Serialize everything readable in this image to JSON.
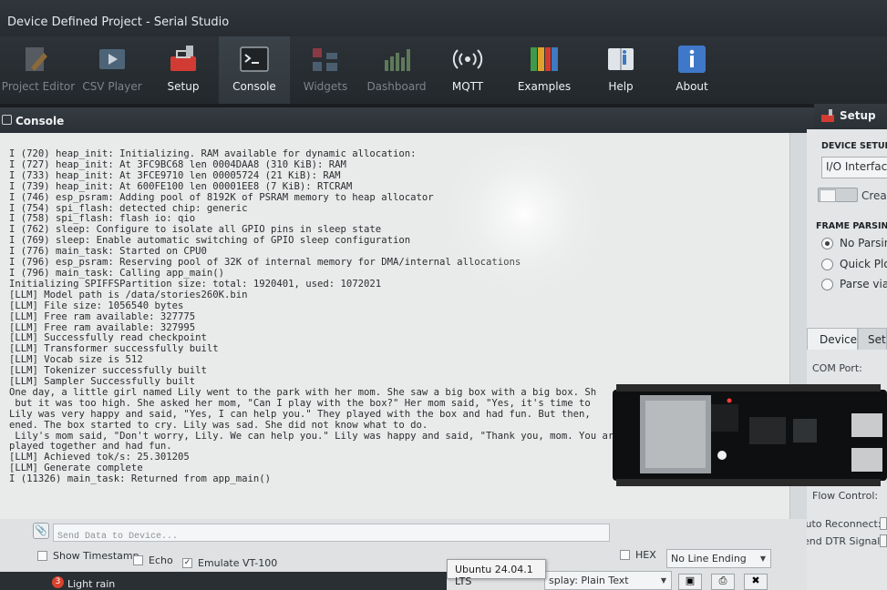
{
  "window": {
    "title": "Device Defined Project - Serial Studio"
  },
  "toolbar": {
    "items": [
      {
        "label": "Project Editor",
        "icon": "pencil-icon"
      },
      {
        "label": "CSV Player",
        "icon": "play-icon"
      },
      {
        "label": "Setup",
        "icon": "toolbox-icon"
      },
      {
        "label": "Console",
        "icon": "terminal-icon"
      },
      {
        "label": "Widgets",
        "icon": "widgets-icon"
      },
      {
        "label": "Dashboard",
        "icon": "bar-chart-icon"
      },
      {
        "label": "MQTT",
        "icon": "broadcast-icon"
      },
      {
        "label": "Examples",
        "icon": "books-icon"
      },
      {
        "label": "Help",
        "icon": "help-book-icon"
      },
      {
        "label": "About",
        "icon": "info-icon"
      }
    ]
  },
  "console": {
    "title": "Console",
    "lines": [
      "I (720) heap_init: Initializing. RAM available for dynamic allocation:",
      "I (727) heap_init: At 3FC9BC68 len 0004DAA8 (310 KiB): RAM",
      "I (733) heap_init: At 3FCE9710 len 00005724 (21 KiB): RAM",
      "I (739) heap_init: At 600FE100 len 00001EE8 (7 KiB): RTCRAM",
      "I (746) esp_psram: Adding pool of 8192K of PSRAM memory to heap allocator",
      "I (754) spi_flash: detected chip: generic",
      "I (758) spi_flash: flash io: qio",
      "I (762) sleep: Configure to isolate all GPIO pins in sleep state",
      "I (769) sleep: Enable automatic switching of GPIO sleep configuration",
      "I (776) main_task: Started on CPU0",
      "I (796) esp_psram: Reserving pool of 32K of internal memory for DMA/internal allocations",
      "I (796) main_task: Calling app_main()",
      "Initializing SPIFFSPartition size: total: 1920401, used: 1072021",
      "[LLM] Model path is /data/stories260K.bin",
      "[LLM] File size: 1056540 bytes",
      "[LLM] Free ram available: 327775",
      "[LLM] Free ram available: 327995",
      "[LLM] Successfully read checkpoint",
      "[LLM] Transformer successfully built",
      "[LLM] Vocab size is 512",
      "[LLM] Tokenizer successfully built",
      "[LLM] Sampler Successfully built",
      "One day, a little girl named Lily went to the park with her mom. She saw a big box with a big box. Sh",
      " but it was too high. She asked her mom, \"Can I play with the box?\" Her mom said, \"Yes, it's time to",
      "Lily was very happy and said, \"Yes, I can help you.\" They played with the box and had fun. But then,",
      "ened. The box started to cry. Lily was sad. She did not know what to do.",
      " Lily's mom said, \"Don't worry, Lily. We can help you.\" Lily was happy and said, \"Thank you, mom. You are a good friend.\"",
      "played together and had fun.",
      "[LLM] Achieved tok/s: 25.301205",
      "[LLM] Generate complete",
      "I (11326) main_task: Returned from app_main()"
    ]
  },
  "input": {
    "placeholder": "Send Data to Device...",
    "hex_label": "HEX",
    "line_ending": "No Line Ending",
    "show_timestamp": "Show Timestamp",
    "echo": "Echo",
    "emulate_vt100": "Emulate VT-100",
    "display_mode": "splay: Plain Text",
    "tooltip": "Ubuntu 24.04.1 LTS"
  },
  "taskbar": {
    "weather_count": "3",
    "weather_text": "Light rain"
  },
  "setup": {
    "title": "Setup",
    "device_setup_label": "DEVICE SETUP:",
    "io_interface": "I/O Interface",
    "create_label": "Creat",
    "frame_parsing_label": "FRAME PARSING:",
    "radios": [
      "No Parsin",
      "Quick Plo",
      "Parse via J"
    ],
    "tabs": [
      "Device",
      "Set"
    ],
    "fields": [
      "COM Port:",
      "Flow Control:",
      "Auto Reconnect:",
      "Send DTR Signal:"
    ]
  },
  "colors": {
    "toolbar_bg": "#262b30",
    "console_bg": "#e9eaea",
    "setup_bg": "#e3e5e7"
  }
}
